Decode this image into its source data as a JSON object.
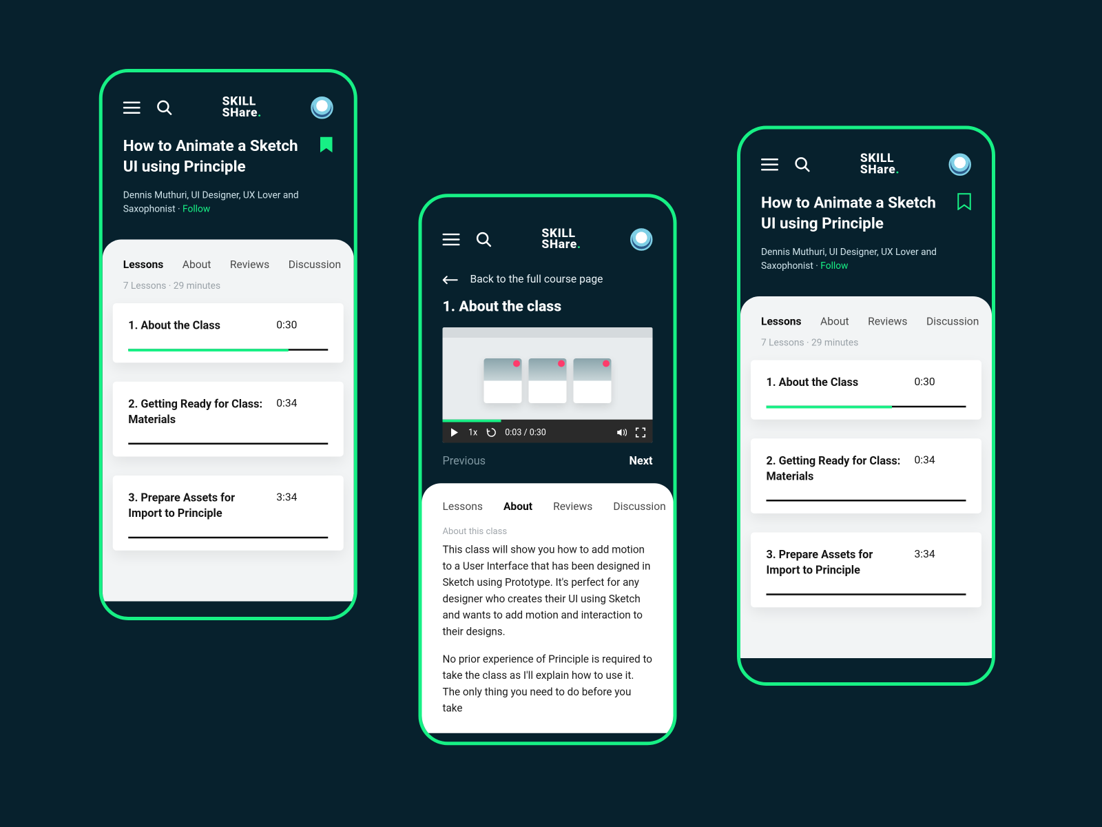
{
  "brand": {
    "line1": "SKILL",
    "line2": "SHare"
  },
  "course": {
    "title": "How to Animate a Sketch UI using Principle",
    "author_line": "Dennis Muthuri, UI Designer, UX Lover and Saxophonist · ",
    "follow": "Follow"
  },
  "tabs": {
    "lessons": "Lessons",
    "about": "About",
    "reviews": "Reviews",
    "discussion": "Discussion"
  },
  "meta": "7 Lessons · 29 minutes",
  "lessons": [
    {
      "title": "1. About the Class",
      "duration": "0:30",
      "progress": 80
    },
    {
      "title": "2. Getting Ready for Class: Materials",
      "duration": "0:34",
      "progress": 0
    },
    {
      "title": "3. Prepare Assets for Import to Principle",
      "duration": "3:34",
      "progress": 0
    }
  ],
  "lesson_view": {
    "back": "Back to the full course page",
    "heading": "1. About the class",
    "speed": "1x",
    "time": "0:03 / 0:30",
    "prev": "Previous",
    "next": "Next",
    "about_heading": "About this class",
    "about_p1": "This class will show you how to add motion to a User Interface that has been designed in Sketch using Prototype. It's perfect for any designer who creates their UI using Sketch and wants to add motion and interaction to their designs.",
    "about_p2": "No prior experience of Principle is required to take the class as I'll explain how to use it. The only thing you need to do before you take"
  }
}
